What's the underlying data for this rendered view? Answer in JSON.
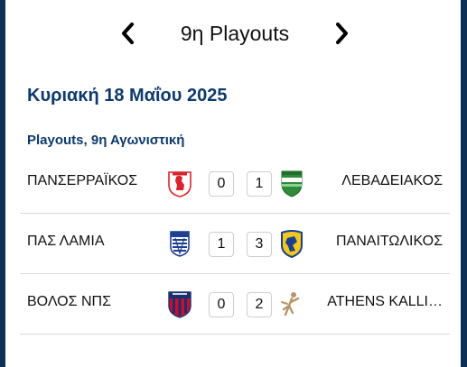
{
  "round": {
    "title": "9η Playouts",
    "prev_icon": "chevron-left-icon",
    "next_icon": "chevron-right-icon"
  },
  "date": "Κυριακή 18 Μαΐου 2025",
  "competition": "Playouts, 9η Αγωνιστική",
  "matches": [
    {
      "home": "ΠΑΝΣΕΡΡΑΪΚΟΣ",
      "home_logo": "panserraikos-crest",
      "home_score": "0",
      "away_score": "1",
      "away": "ΛΕΒΑΔΕΙΑΚΟΣ",
      "away_logo": "levadiakos-crest"
    },
    {
      "home": "ΠΑΣ ΛΑΜΙΑ",
      "home_logo": "lamia-crest",
      "home_score": "1",
      "away_score": "3",
      "away": "ΠΑΝΑΙΤΩΛΙΚΟΣ",
      "away_logo": "panetolikos-crest"
    },
    {
      "home": "ΒΟΛΟΣ ΝΠΣ",
      "home_logo": "volos-crest",
      "home_score": "0",
      "away_score": "2",
      "away": "ATHENS KALLI…",
      "away_logo": "athens-kallithea-crest"
    }
  ],
  "colors": {
    "primary": "#0e3a6b",
    "frame": "#0d2f55",
    "divider": "#d9d9d9"
  }
}
